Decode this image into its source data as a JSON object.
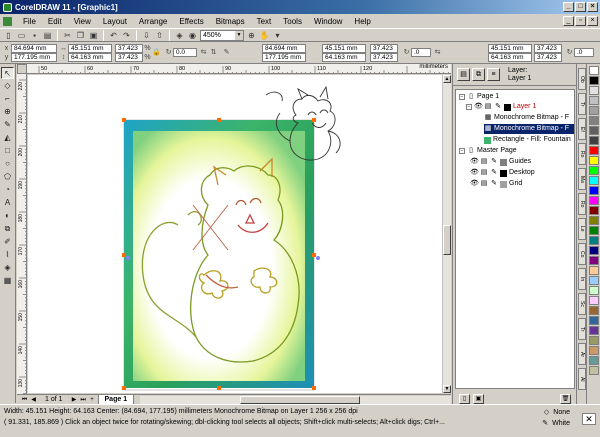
{
  "window": {
    "title": "CorelDRAW 11 - [Graphic1]"
  },
  "menu": [
    "File",
    "Edit",
    "View",
    "Layout",
    "Arrange",
    "Effects",
    "Bitmaps",
    "Text",
    "Tools",
    "Window",
    "Help"
  ],
  "toolbar": {
    "zoom": "450%"
  },
  "propbar": {
    "x": "84.694 mm",
    "y": "177.195 mm",
    "width": "45.151 mm",
    "height": "64.163 mm",
    "scale_w": "37.423",
    "scale_h": "37.423",
    "scale_unit": "%",
    "angle": "0.0",
    "x2": "84.694 mm",
    "y2": "177.195 mm",
    "width2": "45.151 mm",
    "height2": "64.163 mm",
    "scale_w2": "37.423",
    "scale_h2": "37.423",
    "angle2": ".0",
    "x3": "45.151 mm",
    "y3": "64.163 mm",
    "scale_w3": "37.423",
    "scale_h3": "37.423",
    "angle3": ".0"
  },
  "ruler": {
    "unit": "millimeters",
    "ticks": [
      "50",
      "60",
      "70",
      "80",
      "90",
      "100",
      "110",
      "120"
    ],
    "vticks": [
      "220",
      "210",
      "200",
      "190",
      "180",
      "170",
      "160",
      "150",
      "140",
      "130"
    ]
  },
  "pagebar": {
    "count": "1 of 1",
    "tab": "Page 1"
  },
  "docker": {
    "layer_label": "Layer:",
    "layer_name": "Layer 1",
    "tree": {
      "page": "Page 1",
      "layer": "Layer 1",
      "item1": "Monochrome Bitmap - F",
      "item2": "Monochrome Bitmap - F",
      "item3": "Rectangle - Fill: Fountain",
      "master": "Master Page",
      "guides": "Guides",
      "desktop": "Desktop",
      "grid": "Grid"
    }
  },
  "sidetabs": [
    "Ob",
    "Tr",
    "Ef",
    "Ro",
    "Ma",
    "Ro",
    "Le",
    "Co",
    "In",
    "Sc",
    "Tr",
    "Ar",
    "Al"
  ],
  "palette": [
    "#ffffff",
    "#000000",
    "#e0e0e0",
    "#c0c0c0",
    "#a0a0a0",
    "#808080",
    "#606060",
    "#404040",
    "#ff0000",
    "#ffff00",
    "#00ff00",
    "#00ffff",
    "#0000ff",
    "#ff00ff",
    "#800000",
    "#808000",
    "#008000",
    "#008080",
    "#000080",
    "#800080",
    "#ffcc99",
    "#99ccff",
    "#ccffcc",
    "#ffccff",
    "#996633",
    "#336699",
    "#663399",
    "#999966",
    "#cc9966",
    "#669999",
    "#c0c0a0"
  ],
  "status": {
    "line1": "Width: 45.151  Height: 64.163  Center: (84.694, 177.195)  millimeters      Monochrome Bitmap on Layer 1 256 x 256 dpi",
    "line2": "( 91.331, 185.869 )    Click an object twice for rotating/skewing; dbl-clicking tool selects all objects; Shift+click multi-selects; Alt+click digs; Ctrl+...",
    "fill": "None",
    "outline": "White"
  }
}
